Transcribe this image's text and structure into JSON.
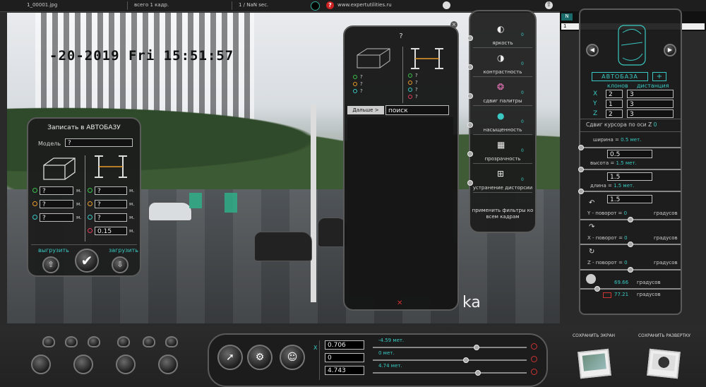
{
  "topbar": {
    "filename": "1_00001.jpg",
    "total_frames": "всего 1 кадр.",
    "frame_rate": "1 / NaN sec.",
    "website": "www.expertutilities.ru"
  },
  "scene": {
    "datetime_overlay": "-20-2019 Fri 15:51:57",
    "watermark_fragment": "ka"
  },
  "autobase_panel": {
    "title": "Записать в АВТОБАЗУ",
    "model_label": "Модель",
    "model_value": "?",
    "left_fields": [
      {
        "color": "#39c24a",
        "value": "?",
        "unit": "м."
      },
      {
        "color": "#e89a2a",
        "value": "?",
        "unit": "м."
      },
      {
        "color": "#39c9c2",
        "value": "?",
        "unit": "м."
      }
    ],
    "right_fields": [
      {
        "color": "#39c24a",
        "value": "?",
        "unit": "м."
      },
      {
        "color": "#e89a2a",
        "value": "?",
        "unit": "м."
      },
      {
        "color": "#39c9c2",
        "value": "?",
        "unit": "м."
      },
      {
        "color": "#e23a5a",
        "value": "0.15",
        "unit": "м."
      }
    ],
    "unload_label": "выгрузить",
    "load_label": "загрузить"
  },
  "search_panel": {
    "title": "?",
    "left_items": [
      {
        "color": "#39c24a",
        "label": "?"
      },
      {
        "color": "#e89a2a",
        "label": "?"
      },
      {
        "color": "#39c9c2",
        "label": "?"
      }
    ],
    "right_items": [
      {
        "color": "#39c24a",
        "label": "?"
      },
      {
        "color": "#e89a2a",
        "label": "?"
      },
      {
        "color": "#39c9c2",
        "label": "?"
      },
      {
        "color": "#e23a5a",
        "label": "?"
      }
    ],
    "next_button": "Дальше >",
    "search_value": "поиск"
  },
  "filter_panel": {
    "items": [
      {
        "label": "яркость",
        "value": "0",
        "icon": "brightness-icon"
      },
      {
        "label": "контрастность",
        "value": "0",
        "icon": "contrast-icon"
      },
      {
        "label": "сдвиг палитры",
        "value": "0",
        "icon": "palette-icon"
      },
      {
        "label": "насыщенность",
        "value": "0",
        "icon": "saturation-icon"
      },
      {
        "label": "прозрачность",
        "value": "0",
        "icon": "transparency-icon"
      },
      {
        "label": "устранение дисторсии",
        "value": "0",
        "icon": "distortion-icon"
      }
    ],
    "apply_label": "применить фильтры ко всем кадрам"
  },
  "grid_header": {
    "col_n": "N",
    "row_1": "1"
  },
  "right_panel": {
    "autobase_button": "АВТОБАЗА",
    "add_button": "+",
    "col_clones": "клонов",
    "col_distance": "дистанция",
    "rows": [
      {
        "axis": "X",
        "clones": "2",
        "distance": "3"
      },
      {
        "axis": "Y",
        "clones": "1",
        "distance": "3"
      },
      {
        "axis": "Z",
        "clones": "2",
        "distance": "3"
      }
    ],
    "cursor_shift_label": "Сдвиг курсора по оси Z",
    "cursor_shift_value": "0",
    "width_label": "ширина =",
    "width_value": "0.5 мет.",
    "width_field": "0.5",
    "height_label": "высота =",
    "height_value": "1.5 мет.",
    "height_field": "1.5",
    "length_label": "длина =",
    "length_value": "1.5 мет.",
    "length_field": "1.5",
    "rot_y_label": "Y - поворот =",
    "rot_y_value": "0",
    "rot_x_label": "X - поворот =",
    "rot_x_value": "0",
    "rot_z_label": "Z - поворот =",
    "rot_z_value": "0",
    "degrees": "градусов",
    "fov1_value": "69.66",
    "fov2_value": "77.21"
  },
  "bottom_panel": {
    "x_label": "X",
    "coords": [
      "0.706",
      "0",
      "4.743"
    ],
    "slider_labels": [
      "-4.59 мет.",
      "0 мет.",
      "4.74 мет."
    ],
    "save_screen": "СОХРАНИТЬ ЭКРАН",
    "save_sweep": "СОХРАНИТЬ РАЗВЕРТКУ"
  }
}
